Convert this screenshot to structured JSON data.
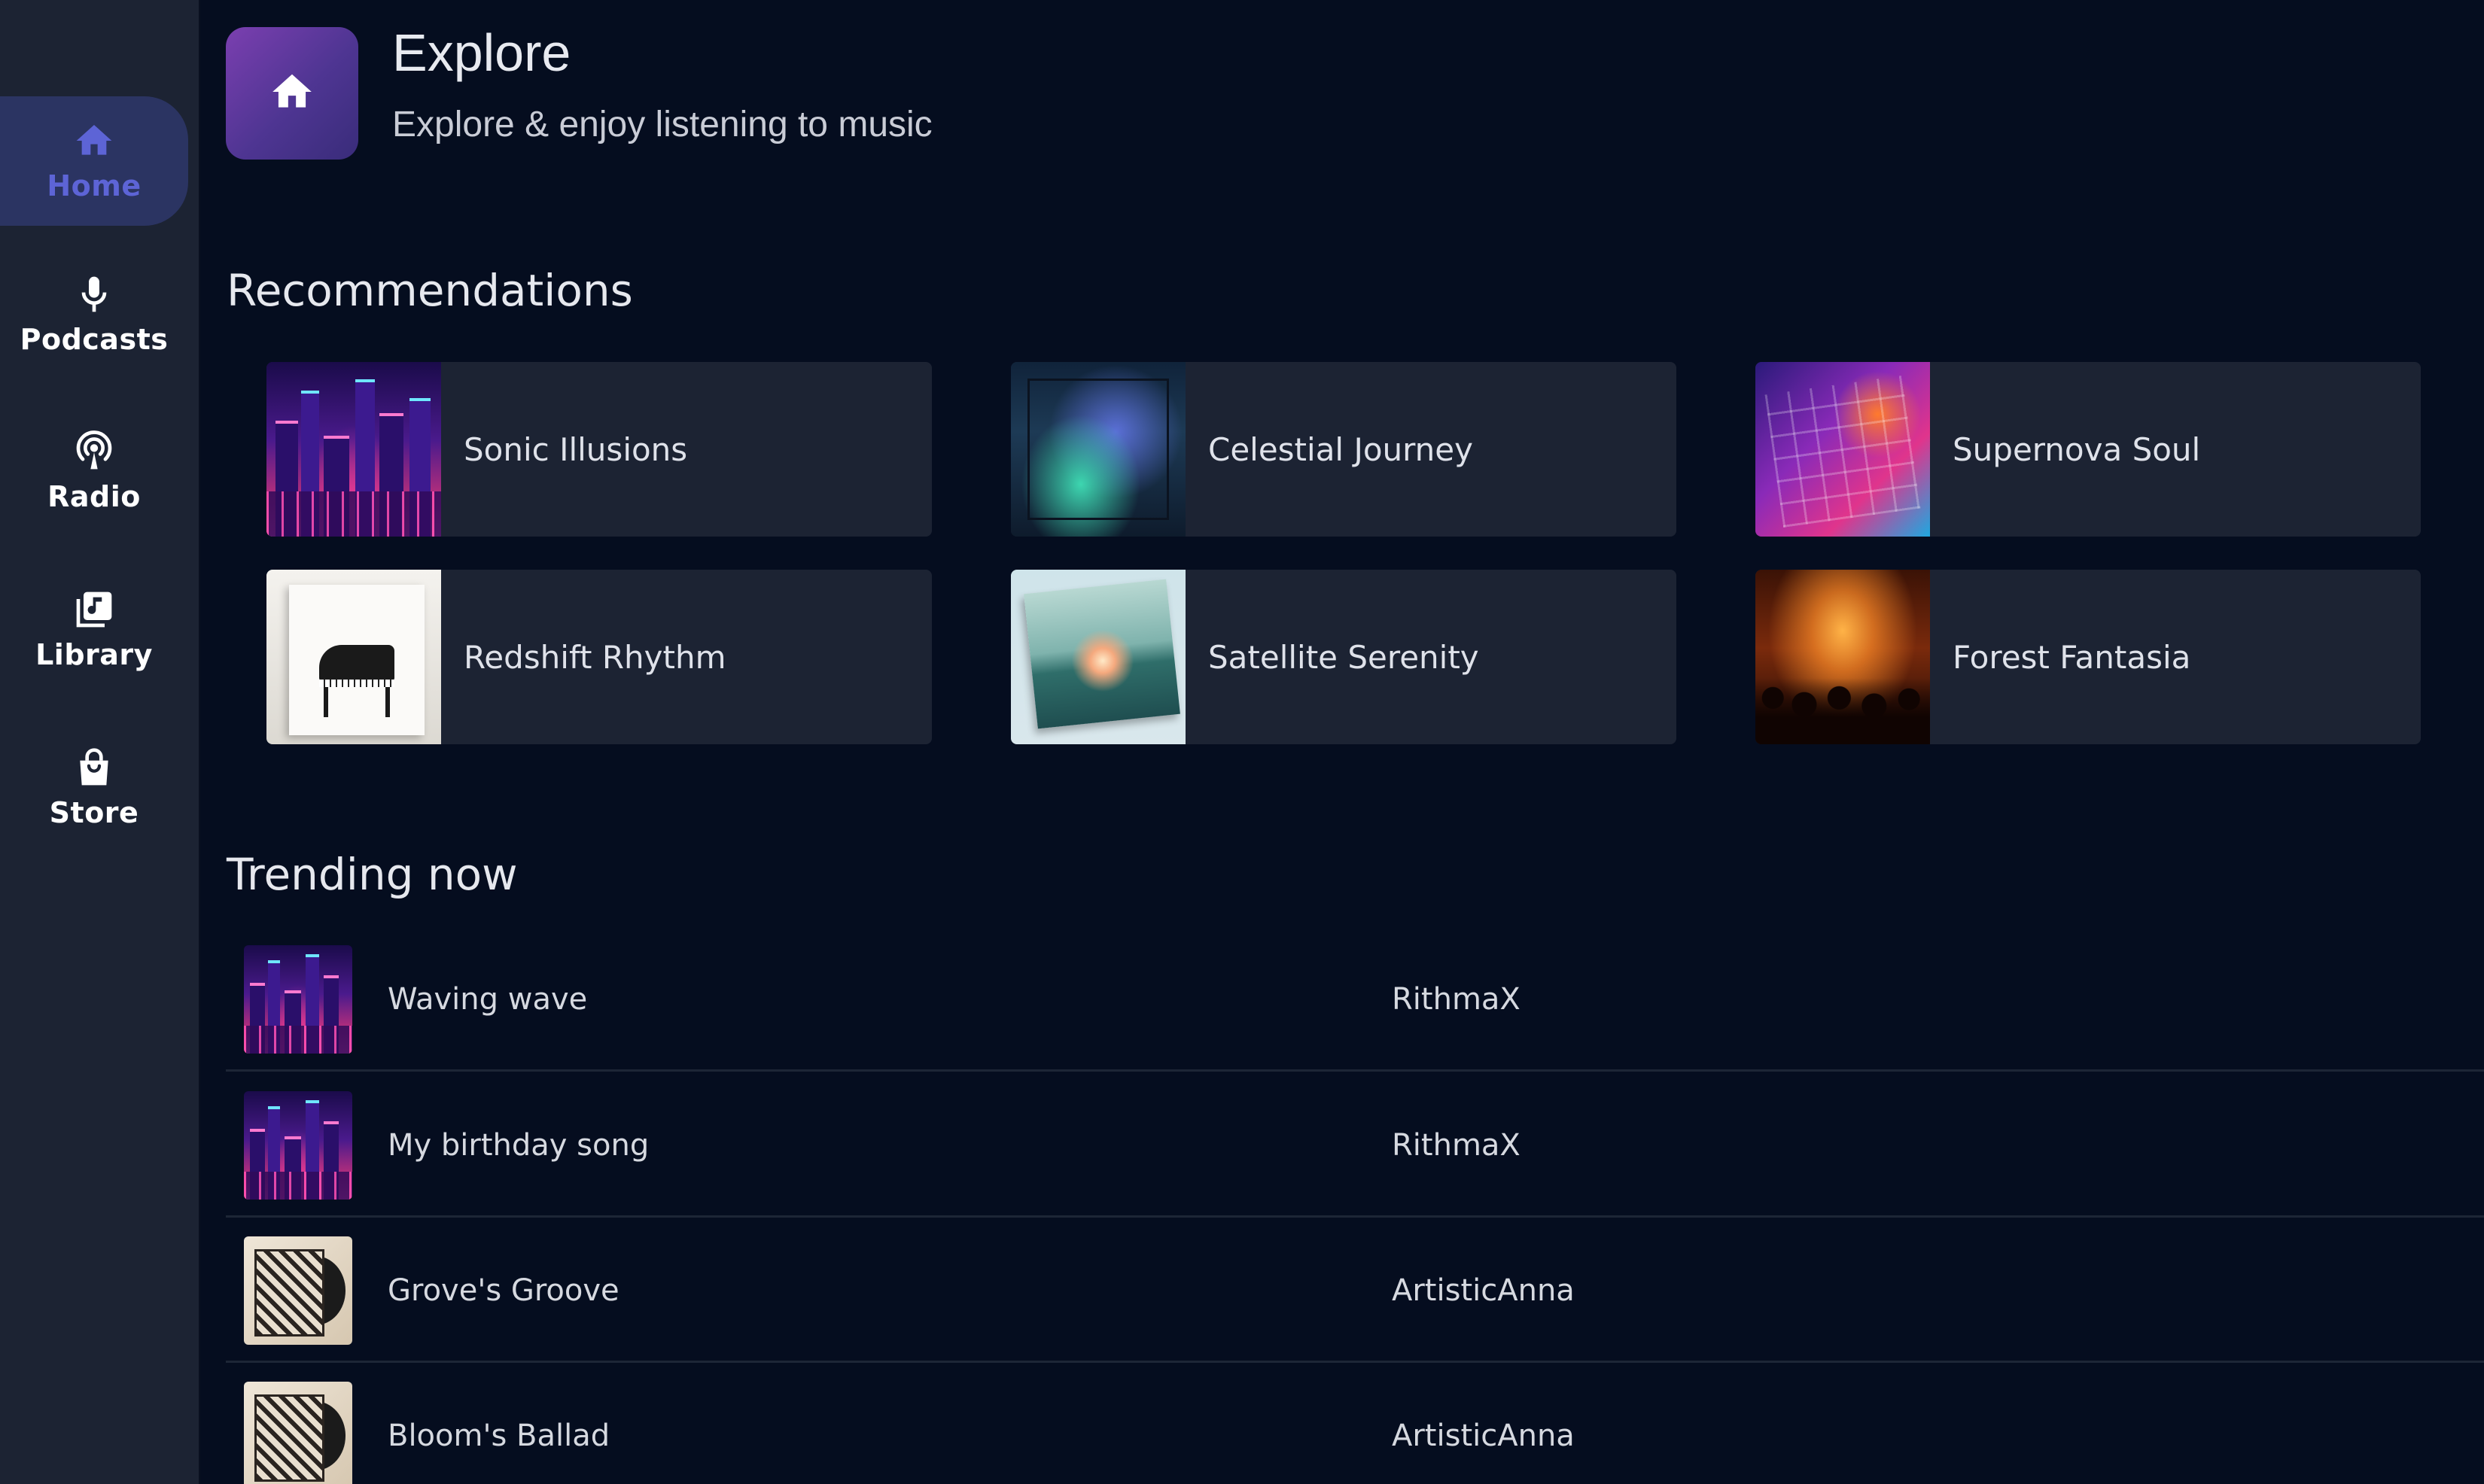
{
  "sidebar": {
    "items": [
      {
        "label": "Home",
        "icon": "home-icon",
        "active": true
      },
      {
        "label": "Podcasts",
        "icon": "microphone-icon",
        "active": false
      },
      {
        "label": "Radio",
        "icon": "radio-icon",
        "active": false
      },
      {
        "label": "Library",
        "icon": "library-icon",
        "active": false
      },
      {
        "label": "Store",
        "icon": "store-icon",
        "active": false
      }
    ]
  },
  "header": {
    "icon": "home-icon",
    "title": "Explore",
    "subtitle": "Explore & enjoy listening to music"
  },
  "recommendations": {
    "heading": "Recommendations",
    "items": [
      {
        "title": "Sonic Illusions",
        "art": "neon-city"
      },
      {
        "title": "Celestial Journey",
        "art": "glowing-waves"
      },
      {
        "title": "Supernova Soul",
        "art": "arcade-rhythms"
      },
      {
        "title": "Redshift Rhythm",
        "art": "grand-piano"
      },
      {
        "title": "Satellite Serenity",
        "art": "soothing-harmonies"
      },
      {
        "title": "Forest Fantasia",
        "art": "jazz-club"
      }
    ]
  },
  "trending": {
    "heading": "Trending now",
    "rows": [
      {
        "title": "Waving wave",
        "artist": "RithmaX",
        "art": "neon-city"
      },
      {
        "title": "My birthday song",
        "artist": "RithmaX",
        "art": "neon-city"
      },
      {
        "title": "Grove's Groove",
        "artist": "ArtisticAnna",
        "art": "indie-record"
      },
      {
        "title": "Bloom's Ballad",
        "artist": "ArtisticAnna",
        "art": "indie-record"
      }
    ]
  },
  "colors": {
    "background": "#050d1f",
    "sidebar": "#1c2333",
    "card": "#1c2333",
    "active_nav_bg": "#2b3462",
    "active_nav_fg": "#5d64d6",
    "header_tile_start": "#7b3fb0",
    "header_tile_end": "#392c7a"
  }
}
